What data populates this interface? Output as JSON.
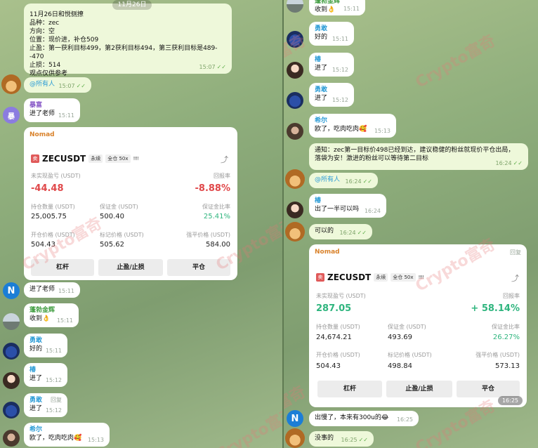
{
  "watermark": "Crypto富奇",
  "left": {
    "date_chip": "11月26日",
    "signal": {
      "lines": [
        "11月26日和悦侧撩",
        "品种：zec",
        "方向：空",
        "位置：现价进，补仓509",
        "止盈：第一获利目标499，第2获利目标494，第三获利目标是489--470",
        "止损：514",
        "观点仅供参考"
      ],
      "time": "15:07"
    },
    "mention_all": {
      "text": "@所有人",
      "time": "15:07"
    },
    "msg_baoyu": {
      "sender": "暴富",
      "text": "进了老师",
      "time": "15:11",
      "avatar_letter": "暴"
    },
    "card": {
      "sender": "Nomad",
      "logo": "卖",
      "ticker": "ZECUSDT",
      "tag1": "永续",
      "tag2": "全仓 50x",
      "bars": "!!!!",
      "share_icon": "share-icon",
      "unrealized_label": "未实现盈亏 (USDT)",
      "unrealized_value": "-44.48",
      "roi_label": "回报率",
      "roi_value": "-8.88%",
      "qty_label": "持仓数量 (USDT)",
      "qty_value": "25,005.75",
      "margin_label": "保证金 (USDT)",
      "margin_value": "500.40",
      "margin_ratio_label": "保证金比率",
      "margin_ratio_value": "25.41%",
      "entry_label": "开仓价格 (USDT)",
      "entry_value": "504.43",
      "mark_label": "标记价格 (USDT)",
      "mark_value": "505.62",
      "liq_label": "强平价格 (USDT)",
      "liq_value": "584.00",
      "btn_leverage": "杠杆",
      "btn_tpsl": "止盈/止损",
      "btn_close": "平仓"
    },
    "msg_n": {
      "text": "进了老师",
      "time": "15:11",
      "avatar_letter": "N"
    },
    "msg_jinhui": {
      "sender": "蓬勃金辉",
      "text": "收到",
      "emoji": "👌",
      "time": "15:11"
    },
    "msg_yonggan": {
      "sender": "勇敢",
      "text": "好的",
      "time": "15:11"
    },
    "msg_chun": {
      "sender": "椿",
      "text": "进了",
      "time": "15:12"
    },
    "msg_yonggan2": {
      "sender": "勇敢",
      "reply": "回复",
      "text": "进了",
      "time": "15:12"
    },
    "msg_xier": {
      "sender": "希尔",
      "text": "欧了，吃肉吃肉",
      "emoji": "🥰",
      "time": "15:13"
    }
  },
  "right": {
    "msg_top": {
      "sender": "蓬勃金辉",
      "text": "收到",
      "emoji": "👌",
      "time": "15:11"
    },
    "msg_yonggan": {
      "sender": "勇敢",
      "text": "好的",
      "time": "15:11"
    },
    "msg_chun": {
      "sender": "椿",
      "text": "进了",
      "time": "15:12"
    },
    "msg_yonggan2": {
      "sender": "勇敢",
      "text": "进了",
      "time": "15:12"
    },
    "msg_xier": {
      "sender": "希尔",
      "text": "欧了，吃肉吃肉",
      "emoji": "🥰",
      "time": "15:13"
    },
    "notice": {
      "lines": [
        "通知：zec第一目标价498已经到达，建议稳健的粉丝就现价平仓出局，",
        "落袋为安！激进的粉丝可以等待第二目标"
      ],
      "time": "16:24"
    },
    "mention_all": {
      "text": "@所有人",
      "time": "16:24"
    },
    "msg_chun2": {
      "sender": "椿",
      "text": "出了一半可以吗",
      "time": "16:24"
    },
    "msg_keyi": {
      "text": "可以的",
      "time": "16:24"
    },
    "card": {
      "sender": "Nomad",
      "reply": "回复",
      "logo": "卖",
      "ticker": "ZECUSDT",
      "tag1": "永续",
      "tag2": "全仓 50x",
      "bars": "!!!!",
      "share_icon": "share-icon",
      "unrealized_label": "未实现盈亏 (USDT)",
      "unrealized_value": "287.05",
      "roi_label": "回报率",
      "roi_value": "+ 58.14%",
      "qty_label": "持仓数量 (USDT)",
      "qty_value": "24,674.21",
      "margin_label": "保证金 (USDT)",
      "margin_value": "493.69",
      "margin_ratio_label": "保证金比率",
      "margin_ratio_value": "26.27%",
      "entry_label": "开仓价格 (USDT)",
      "entry_value": "504.43",
      "mark_label": "标记价格 (USDT)",
      "mark_value": "498.84",
      "liq_label": "强平价格 (USDT)",
      "liq_value": "573.13",
      "btn_leverage": "杠杆",
      "btn_tpsl": "止盈/止损",
      "btn_close": "平仓",
      "time": "16:25"
    },
    "msg_n": {
      "text": "出慢了，本来有300u的",
      "emoji": "😂",
      "time": "16:25",
      "avatar_letter": "N"
    },
    "msg_last": {
      "text": "没事的",
      "time": "16:25"
    }
  }
}
